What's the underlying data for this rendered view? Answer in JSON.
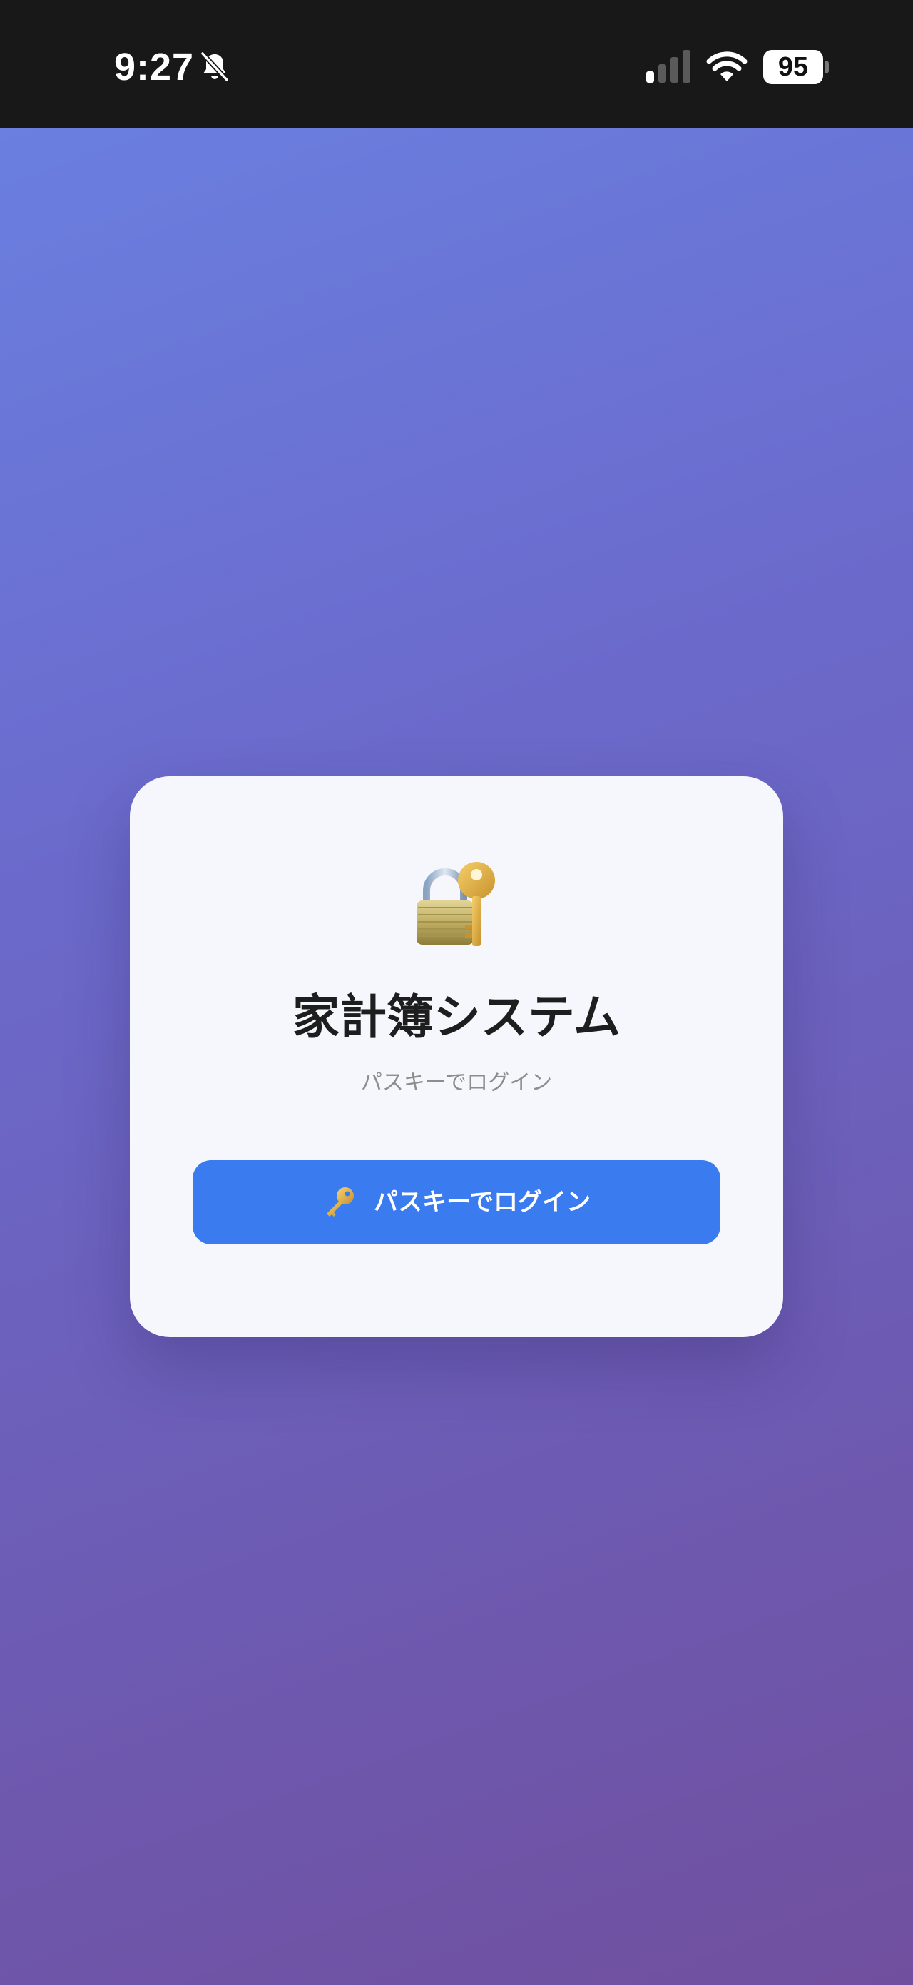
{
  "status_bar": {
    "time": "9:27",
    "battery_percent": "95",
    "icons": [
      "bell-slash-icon",
      "cellular-signal-icon",
      "wifi-icon",
      "battery-icon"
    ],
    "signal_bars": 1
  },
  "background": {
    "gradient_start": "#6a7fe0",
    "gradient_end": "#704f9e"
  },
  "login_card": {
    "icon": "lock-with-key-icon",
    "title": "家計簿システム",
    "subtitle": "パスキーでログイン",
    "button": {
      "icon": "key-icon",
      "label": "パスキーでログイン",
      "color": "#3a7bf0"
    }
  }
}
